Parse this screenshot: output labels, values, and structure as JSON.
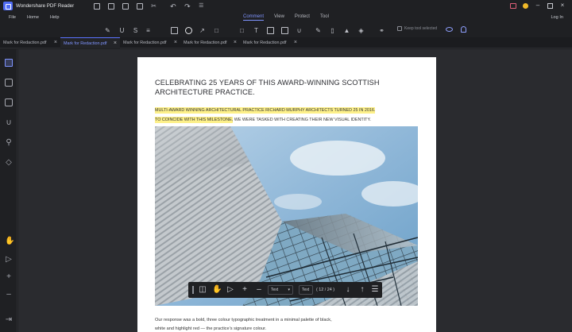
{
  "app": {
    "title": "Wondershare PDF Reader"
  },
  "menu": {
    "left": [
      "File",
      "Home",
      "Help"
    ],
    "center": [
      "Comment",
      "View",
      "Protect",
      "Tool"
    ],
    "active": "Comment",
    "login": "Log In"
  },
  "toolbar": {
    "keep_tool_selected": "Keep tool selected"
  },
  "tabs": [
    {
      "label": "Mark for Redaction.pdf",
      "active": false
    },
    {
      "label": "Mark for Redaction.pdf",
      "active": true
    },
    {
      "label": "Mark for Redaction.pdf",
      "active": false
    },
    {
      "label": "Mark for Redaction.pdf",
      "active": false
    },
    {
      "label": "Mark for Redaction.pdf",
      "active": false
    }
  ],
  "document": {
    "title": "CELEBRATING 25 YEARS OF THIS AWARD-WINNING SCOTTISH ARCHITECTURE PRACTICE.",
    "highlight_line1": "MULTI-AWARD WINNING ARCHITECTURAL PRACTICE RICHARD MURPHY ARCHITECTS TURNED 25 IN 2016.",
    "highlight_line2": "TO COINCIDE WITH THIS MILESTONE,",
    "normal_tail": " WE WERE TASKED WITH CREATING THEIR NEW VISUAL IDENTITY.",
    "para_line1": "Our response was a bold, three colour typographic treatment in a minimal palette of black,",
    "para_line2": "white and highlight red — the practice’s signature colour."
  },
  "floating_toolbar": {
    "font_field": "Text",
    "size_field": "Text",
    "page_indicator": "( 12 / 24 )"
  },
  "colors": {
    "accent": "#7f94ff",
    "highlight": "#fdf08a",
    "background": "#2a2b2f"
  }
}
